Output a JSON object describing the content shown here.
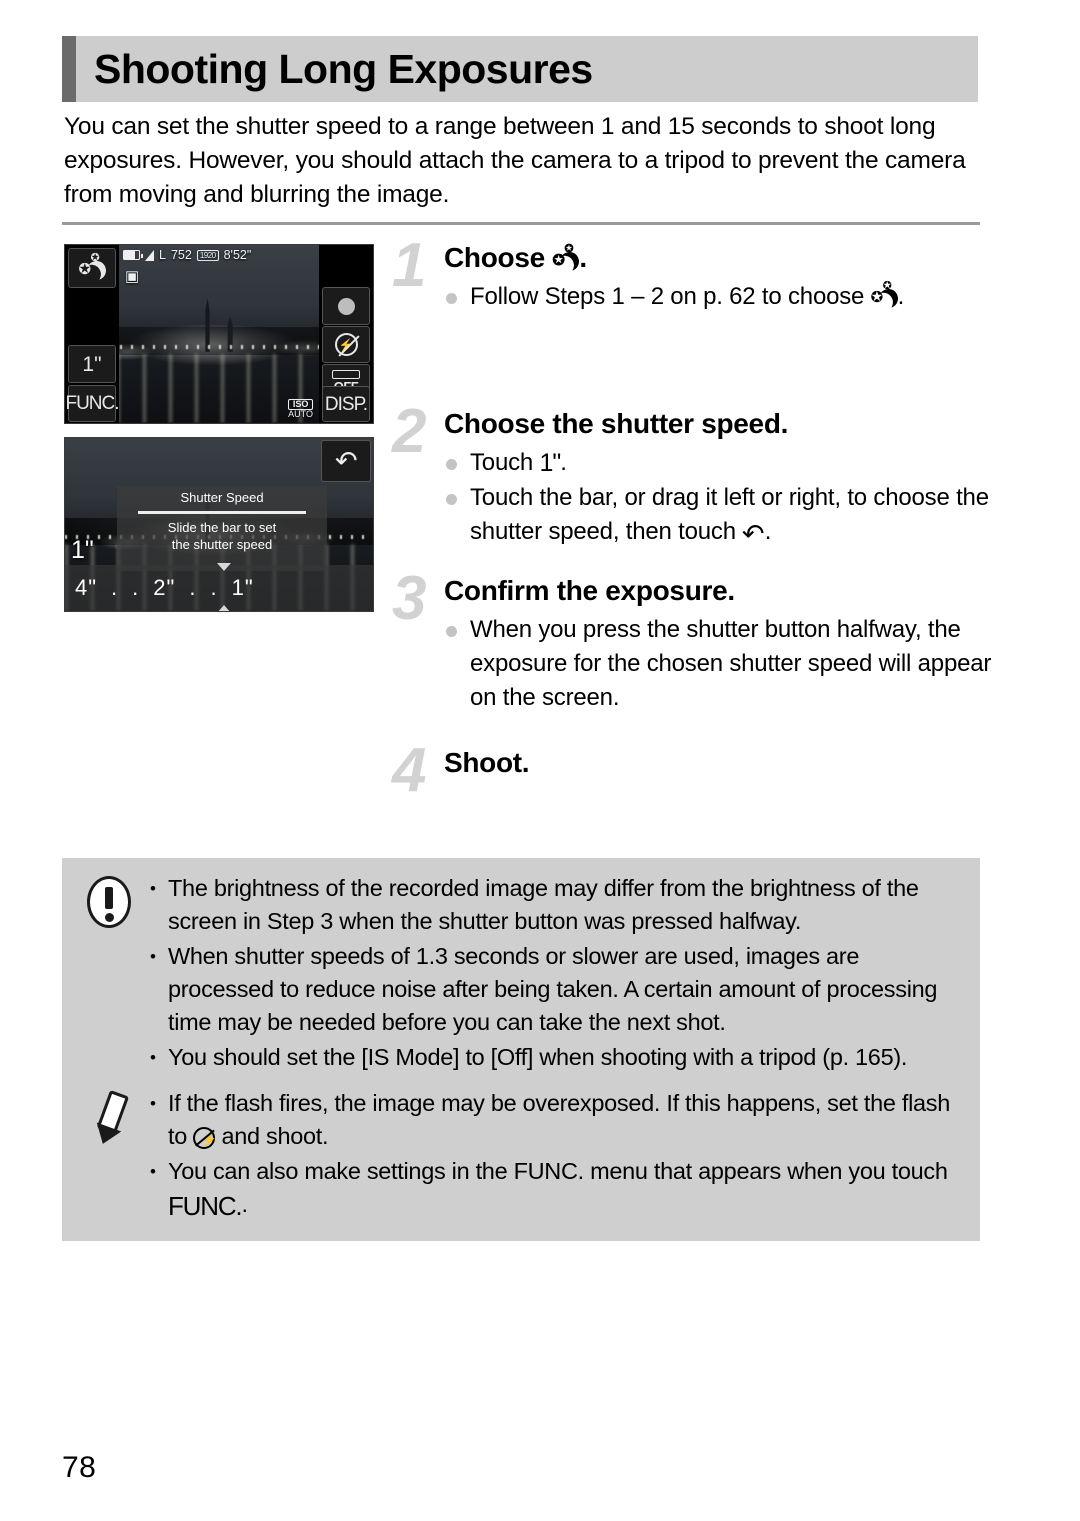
{
  "title": "Shooting Long Exposures",
  "intro": "You can set the shutter speed to a range between 1 and 15 seconds to shoot long exposures. However, you should attach the camera to a tripod to prevent the camera from moving and blurring the image.",
  "page_number": "78",
  "colors": {
    "title_bg": "#cdcdcd",
    "title_accent": "#6b6b6b",
    "callout_bg": "#cfcfcf",
    "step_number": "#d2d2d2",
    "bullet": "#c4c4c4",
    "divider": "#9a9a9a"
  },
  "screenshot_1": {
    "name": "shooting-screen",
    "status": {
      "battery": "battery-icon",
      "quality": "L",
      "shots_remaining": "752",
      "movie_quality": "1920",
      "movie_time": "8'52\""
    },
    "mode_icon": "night-scene-icon",
    "camera_icon": "still-image-icon",
    "shutter_button_label": "1\"",
    "func_label": "FUNC.",
    "record_button": "record-icon",
    "flash_button": "flash-off-icon",
    "is_button_label": "OFF",
    "disp_label": "DISP.",
    "iso_label": "ISO",
    "iso_value": "AUTO"
  },
  "screenshot_2": {
    "name": "shutter-speed-screen",
    "back_icon": "back-arrow-icon",
    "dialog_title": "Shutter Speed",
    "dialog_message_line1": "Slide the bar to set",
    "dialog_message_line2": "the shutter speed",
    "current_value": "1\"",
    "scale": [
      "4\"",
      ".",
      ".",
      "2\"",
      ".",
      ".",
      "1\""
    ]
  },
  "steps": [
    {
      "number": "1",
      "heading_before": "Choose ",
      "heading_icon": "night-scene-icon",
      "heading_after": ".",
      "bullets": [
        {
          "before": "Follow Steps 1 – 2 on p. 62 to choose ",
          "icon": "night-scene-icon",
          "after": "."
        }
      ]
    },
    {
      "number": "2",
      "heading_before": "Choose the shutter speed.",
      "heading_icon": "",
      "heading_after": "",
      "bullets": [
        {
          "before": "Touch ",
          "icon": "one-second-icon",
          "after": "."
        },
        {
          "before": "Touch the bar, or drag it left or right, to choose the shutter speed, then touch ",
          "icon": "back-arrow-icon",
          "after": "."
        }
      ]
    },
    {
      "number": "3",
      "heading_before": "Confirm the exposure.",
      "heading_icon": "",
      "heading_after": "",
      "bullets": [
        {
          "before": "When you press the shutter button halfway, the exposure for the chosen shutter speed will appear on the screen.",
          "icon": "",
          "after": ""
        }
      ]
    },
    {
      "number": "4",
      "heading_before": "Shoot.",
      "heading_icon": "",
      "heading_after": "",
      "bullets": []
    }
  ],
  "warning_box": {
    "icon": "warning-icon",
    "items": [
      "The brightness of the recorded image may differ from the brightness of the screen in Step 3 when the shutter button was pressed halfway.",
      "When shutter speeds of 1.3 seconds or slower are used, images are processed to reduce noise after being taken. A certain amount of processing time may be needed before you can take the next shot.",
      "You should set the [IS Mode] to [Off] when shooting with a tripod (p. 165)."
    ]
  },
  "note_box": {
    "icon": "pencil-icon",
    "item1_before": "If the flash fires, the image may be overexposed. If this happens, set the flash to ",
    "item1_icon": "flash-off-icon",
    "item1_after": " and shoot.",
    "item2_before": "You can also make settings in the FUNC. menu that appears when you touch ",
    "item2_icon": "FUNC.",
    "item2_after": "."
  }
}
